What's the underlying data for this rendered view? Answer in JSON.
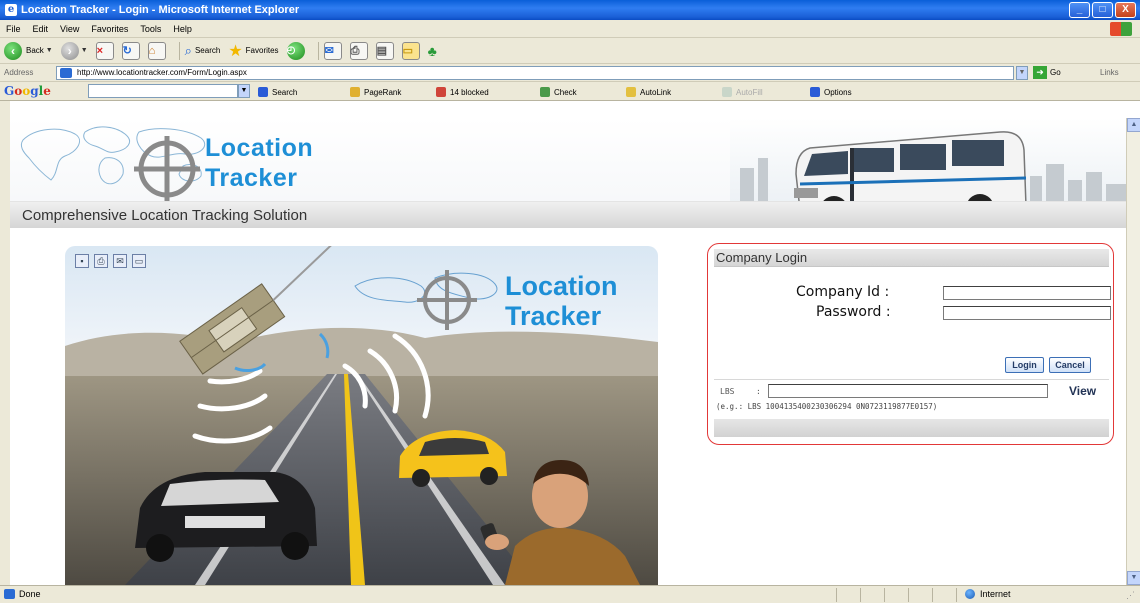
{
  "window": {
    "title": "Location Tracker - Login - Microsoft Internet Explorer",
    "buttons": {
      "minimize": "_",
      "maximize": "□",
      "close": "X"
    }
  },
  "menu": [
    "File",
    "Edit",
    "View",
    "Favorites",
    "Tools",
    "Help"
  ],
  "toolbar": {
    "back_label": "Back",
    "search_label": "Search",
    "favorites_label": "Favorites"
  },
  "address": {
    "label": "Address",
    "url": "http://www.locationtracker.com/Form/Login.aspx",
    "go_label": "Go",
    "links_label": "Links"
  },
  "googlebar": {
    "search_label": "Search",
    "pagerank_label": "PageRank",
    "blocked_label": "14 blocked",
    "check_label": "Check",
    "autolink_label": "AutoLink",
    "autofill_label": "AutoFill",
    "options_label": "Options"
  },
  "site": {
    "logo_line1": "Location",
    "logo_line2": "Tracker",
    "tagline": "Comprehensive Location Tracking Solution"
  },
  "hero": {
    "logo_line1": "Location",
    "logo_line2": "Tracker"
  },
  "login": {
    "title": "Company Login",
    "company_id_label": "Company Id :",
    "password_label": "Password :",
    "login_button": "Login",
    "cancel_button": "Cancel",
    "lbs_label": "LBS",
    "lbs_colon": ":",
    "view_link": "View",
    "lbs_example": "(e.g.: LBS 1004135400230306294 0N0723119877E0157)"
  },
  "status": {
    "left": "Done",
    "zone": "Internet"
  },
  "colors": {
    "logo_blue": "#1e8fd6",
    "login_border": "#e23838",
    "xp_blue": "#1b5ed5"
  }
}
